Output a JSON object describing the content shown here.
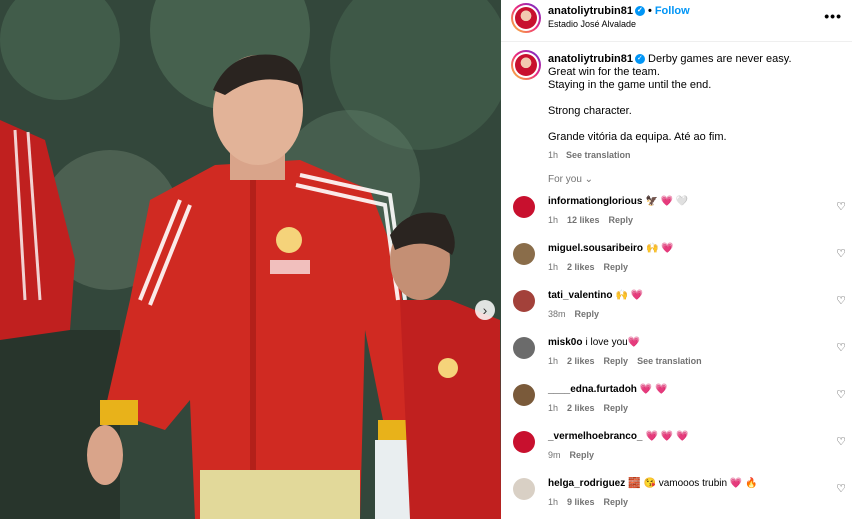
{
  "post": {
    "username": "anatoliytrubin81",
    "follow_label": "Follow",
    "location": "Estadio José Alvalade",
    "more_label": "•••",
    "next_glyph": "›"
  },
  "caption": {
    "username": "anatoliytrubin81",
    "text": "Derby games are never easy.\nGreat win for the team.\nStaying in the game until the end.\n\nStrong character.\n\nGrande vitória da equipa. Até ao fim.",
    "time": "1h",
    "see_translation": "See translation"
  },
  "for_you_label": "For you ⌄",
  "comments": [
    {
      "user": "informationglorious",
      "text": "🦅 💗 🤍",
      "time": "1h",
      "likes": "12 likes",
      "reply": "Reply",
      "extra": "",
      "avatar_color": "#c8102e"
    },
    {
      "user": "miguel.sousaribeiro",
      "text": "🙌 💗",
      "time": "1h",
      "likes": "2 likes",
      "reply": "Reply",
      "extra": "",
      "avatar_color": "#8a6d4a"
    },
    {
      "user": "tati_valentino",
      "text": "🙌 💗",
      "time": "38m",
      "likes": "",
      "reply": "Reply",
      "extra": "",
      "avatar_color": "#a3413a"
    },
    {
      "user": "misk0o",
      "text": "i love you💗",
      "time": "1h",
      "likes": "2 likes",
      "reply": "Reply",
      "extra": "See translation",
      "avatar_color": "#6b6b6b"
    },
    {
      "user": "____edna.furtadoh",
      "text": "💗 💗",
      "time": "1h",
      "likes": "2 likes",
      "reply": "Reply",
      "extra": "",
      "avatar_color": "#7a5a3a"
    },
    {
      "user": "_vermelhoebranco_",
      "text": "💗 💗 💗",
      "time": "9m",
      "likes": "",
      "reply": "Reply",
      "extra": "",
      "avatar_color": "#c8102e"
    },
    {
      "user": "helga_rodriguez",
      "text": "🧱 😘 vamooos trubin 💗 🔥",
      "time": "1h",
      "likes": "9 likes",
      "reply": "Reply",
      "extra": "",
      "avatar_color": "#d9d0c5"
    }
  ],
  "like_glyph": "♡"
}
